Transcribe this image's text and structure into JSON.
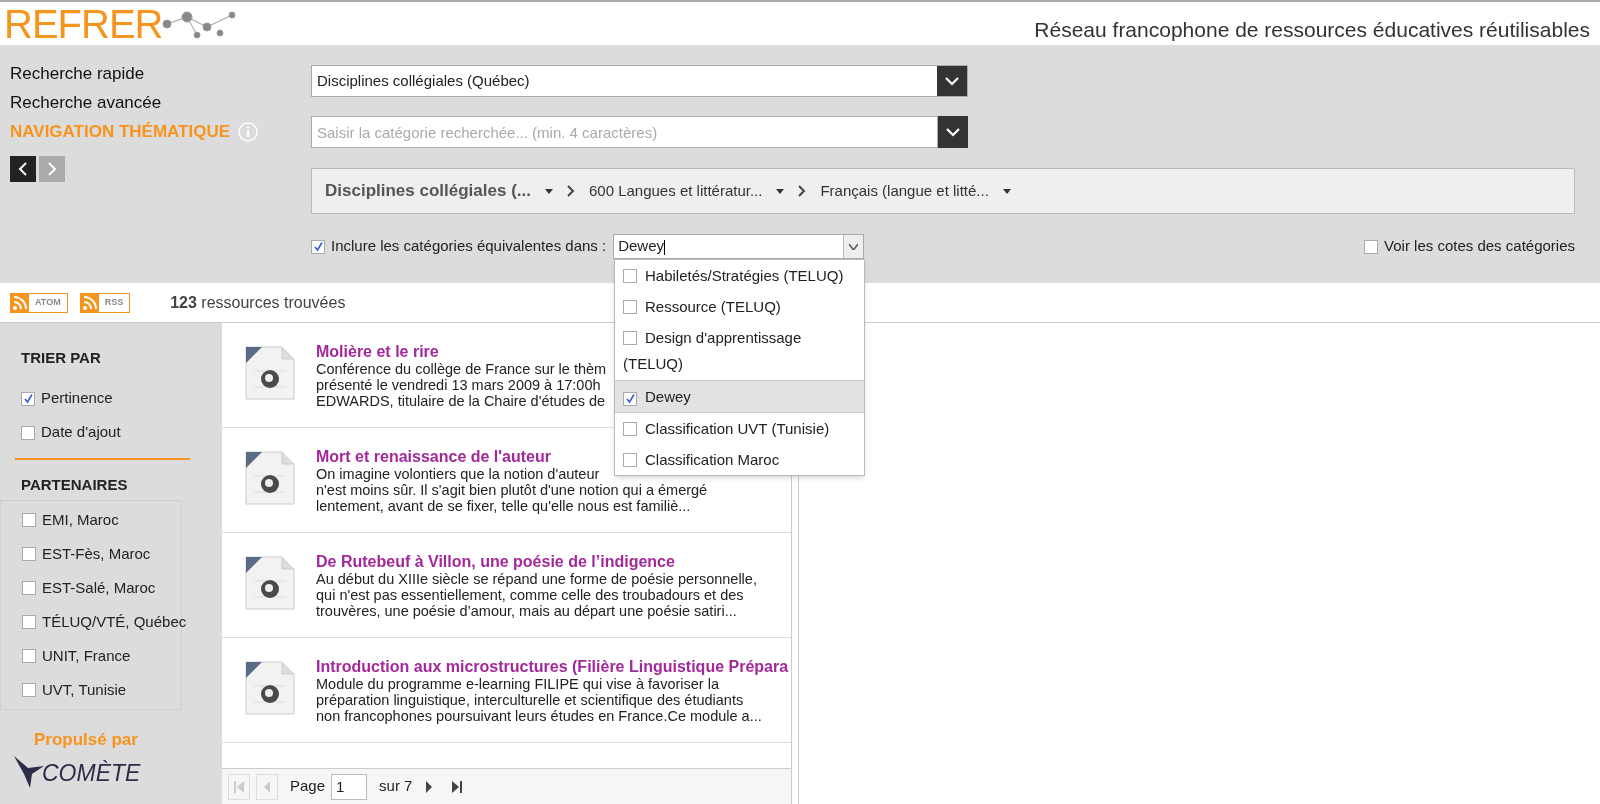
{
  "header": {
    "logo": "REFRER",
    "tagline": "Réseau francophone de ressources éducatives réutilisables"
  },
  "search_modes": [
    {
      "label": "Recherche rapide",
      "selected": false
    },
    {
      "label": "Recherche avancée",
      "selected": false
    },
    {
      "label": "NAVIGATION THÉMATIQUE",
      "selected": true
    }
  ],
  "taxonomy_select": {
    "value": "Disciplines collégiales (Québec)"
  },
  "category_field": {
    "placeholder": "Saisir la catégorie recherchée... (min. 4 caractères)"
  },
  "breadcrumb": [
    {
      "label": "Disciplines collégiales (...",
      "selected": true
    },
    {
      "label": "600 Langues et littératur...",
      "selected": false
    },
    {
      "label": "Français (langue et litté...",
      "selected": false
    }
  ],
  "include_equivalents": {
    "checked": true,
    "label": "Inclure les catégories équivalentes dans :",
    "value": "Dewey",
    "options": [
      {
        "label": "Habiletés/Stratégies (TELUQ)",
        "checked": false,
        "selected": false
      },
      {
        "label": "Ressource (TELUQ)",
        "checked": false,
        "selected": false
      },
      {
        "label": "Design d'apprentissage (TELUQ)",
        "checked": false,
        "selected": false
      },
      {
        "label": "Dewey",
        "checked": true,
        "selected": true
      },
      {
        "label": "Classification UVT (Tunisie)",
        "checked": false,
        "selected": false
      },
      {
        "label": "Classification Maroc",
        "checked": false,
        "selected": false
      }
    ]
  },
  "show_codes": {
    "checked": false,
    "label": "Voir les cotes des catégories"
  },
  "feeds": [
    "ATOM",
    "RSS"
  ],
  "result_count": "**123** ressources trouvées",
  "sort": {
    "title": "TRIER PAR",
    "options": [
      {
        "label": "Pertinence",
        "checked": true
      },
      {
        "label": "Date d'ajout",
        "checked": false
      }
    ]
  },
  "partners": {
    "title": "PARTENAIRES",
    "options": [
      {
        "label": "EMI, Maroc",
        "checked": false
      },
      {
        "label": "EST-Fès, Maroc",
        "checked": false
      },
      {
        "label": "EST-Salé, Maroc",
        "checked": false
      },
      {
        "label": "TÉLUQ/VTÉ, Québec",
        "checked": false
      },
      {
        "label": "UNIT, France",
        "checked": false
      },
      {
        "label": "UVT, Tunisie",
        "checked": false
      }
    ]
  },
  "powered_by": {
    "label": "Propulsé par",
    "brand": "COMÈTE"
  },
  "results": [
    {
      "title": "Molière et le rire",
      "lines": [
        "Conférence du collège de France sur le thèm",
        "présenté le vendredi 13 mars 2009 à 17:00h",
        "EDWARDS, titulaire de la Chaire d'études de"
      ]
    },
    {
      "title": "Mort et renaissance de l'auteur",
      "lines": [
        "On imagine volontiers que la notion d'auteur",
        "n'est moins sûr. Il s'agit bien plutôt d'une notion qui a émergé",
        "lentement, avant de se fixer, telle qu'elle nous est familiè..."
      ]
    },
    {
      "title": "De Rutebeuf à Villon, une poésie de l’indigence",
      "lines": [
        "Au début du XIIIe siècle se répand une forme de poésie personnelle,",
        "qui n'est pas essentiellement, comme celle des troubadours et des",
        "trouvères, une poésie d’amour, mais au départ une poésie satiri..."
      ]
    },
    {
      "title": "Introduction aux microstructures (Filière Linguistique Prépara",
      "lines": [
        "Module du programme e-learning FILIPE qui vise à favoriser la",
        "préparation linguistique, interculturelle et scientifique des étudiants",
        "non francophones poursuivant leurs études en France.Ce module a..."
      ]
    }
  ],
  "pagination": {
    "page_label": "Page",
    "page": "1",
    "total": "sur 7"
  }
}
